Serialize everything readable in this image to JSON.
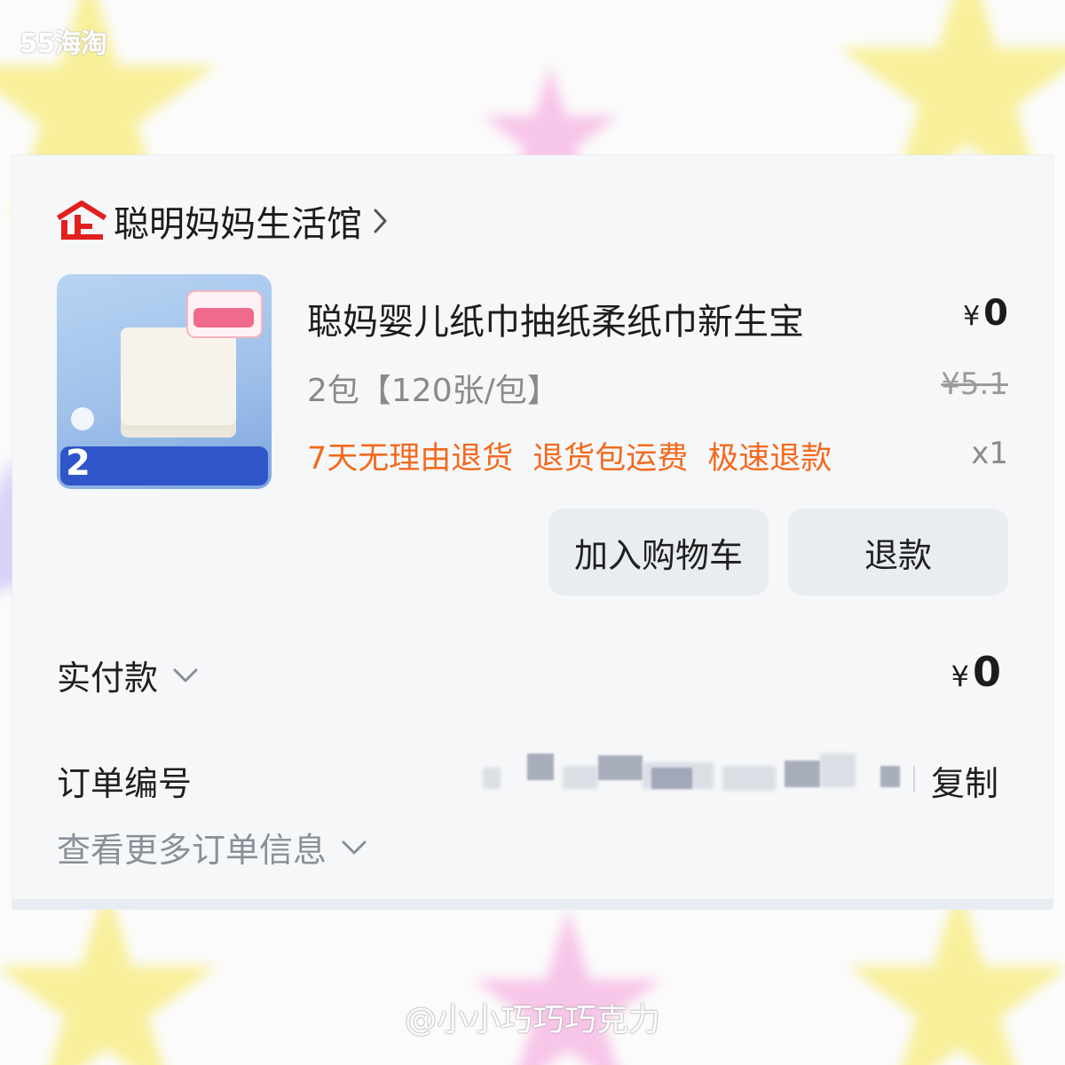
{
  "watermark_top_left": "55海淘",
  "watermark_bottom": "@小小巧巧巧克力",
  "colors": {
    "brand_red": "#e11f1f",
    "tag_orange": "#f36a1e",
    "button_bg": "#e9ecf0",
    "muted_text": "#8a8a8a"
  },
  "shop": {
    "icon": "enterprise-store-icon",
    "name": "聪明妈妈生活馆"
  },
  "product": {
    "image_alt": "product-thumbnail",
    "thumb_number": "2",
    "title": "聪妈婴儿纸巾抽纸柔纸巾新生宝",
    "price_symbol": "¥",
    "price_value": "0",
    "spec": "2包【120张/包】",
    "original_price": "¥5.1",
    "service_tags": [
      "7天无理由退货",
      "退货包运费",
      "极速退款"
    ],
    "quantity": "x1"
  },
  "actions": {
    "add_to_cart": "加入购物车",
    "refund": "退款"
  },
  "payment": {
    "label": "实付款",
    "symbol": "¥",
    "value": "0"
  },
  "order": {
    "number_label": "订单编号",
    "copy_label": "复制",
    "more_info_label": "查看更多订单信息"
  }
}
